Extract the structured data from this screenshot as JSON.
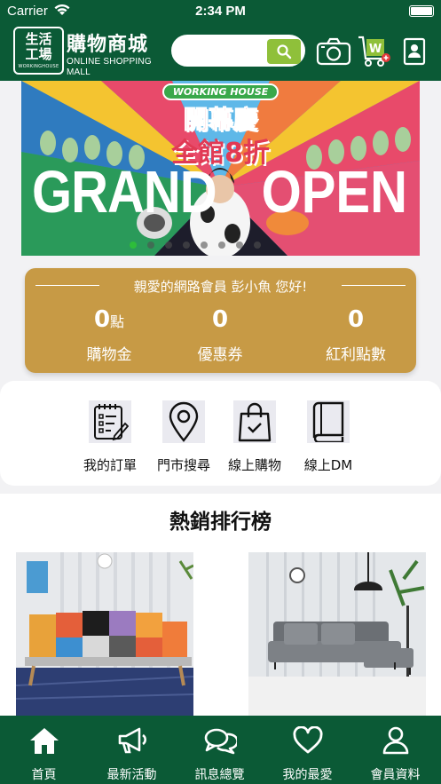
{
  "status_bar": {
    "carrier": "Carrier",
    "time": "2:34 PM"
  },
  "header": {
    "logo_line1": "生活",
    "logo_line2": "工場",
    "logo_sub": "WORKINGHOUSE",
    "brand_zh": "購物商城",
    "brand_en": "ONLINE SHOPPING MALL",
    "search_placeholder": "",
    "icons": [
      "camera-icon",
      "cart-icon",
      "member-card-icon"
    ]
  },
  "banner": {
    "tag": "WORKING HOUSE",
    "headline1": "開幕慶",
    "headline2": "全館8折",
    "left_word": "GRAND",
    "right_word": "OPEN",
    "slide_count": 8,
    "active_slide": 0
  },
  "member": {
    "greeting": "親愛的網路會員 彭小魚 您好!",
    "stats": [
      {
        "value": "0",
        "unit": "點",
        "label": "購物金"
      },
      {
        "value": "0",
        "unit": "",
        "label": "優惠券"
      },
      {
        "value": "0",
        "unit": "",
        "label": "紅利點數"
      }
    ]
  },
  "quick_actions": [
    {
      "label": "我的訂單",
      "icon": "order-list-icon"
    },
    {
      "label": "門市搜尋",
      "icon": "location-pin-icon"
    },
    {
      "label": "線上購物",
      "icon": "shopping-bag-icon"
    },
    {
      "label": "線上DM",
      "icon": "book-icon"
    }
  ],
  "ranking": {
    "title": "熱銷排行榜"
  },
  "tabbar": [
    {
      "label": "首頁",
      "icon": "home-icon"
    },
    {
      "label": "最新活動",
      "icon": "megaphone-icon"
    },
    {
      "label": "訊息總覽",
      "icon": "chat-bubbles-icon"
    },
    {
      "label": "我的最愛",
      "icon": "heart-icon"
    },
    {
      "label": "會員資料",
      "icon": "person-icon"
    }
  ],
  "colors": {
    "primary_green": "#0b5a36",
    "accent_green": "#8fc03a",
    "gold": "#c79a45"
  }
}
